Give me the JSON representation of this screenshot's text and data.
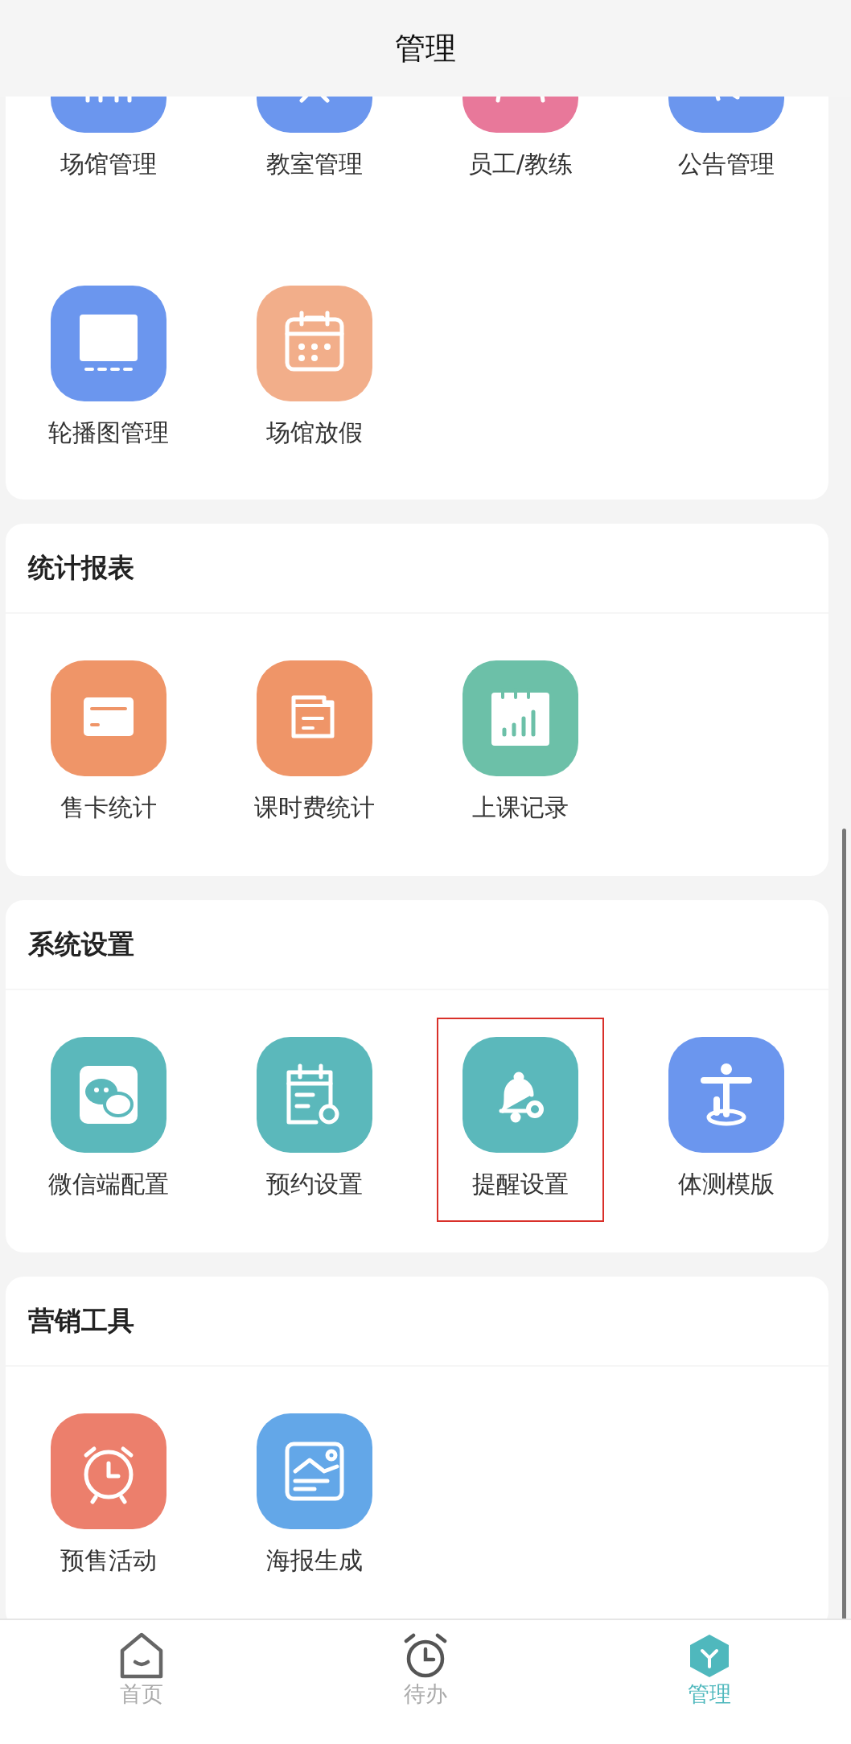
{
  "header": {
    "title": "管理"
  },
  "sections": [
    {
      "items": [
        {
          "label": "场馆管理",
          "kind": "building",
          "color": "#6b96ee"
        },
        {
          "label": "教室管理",
          "kind": "classroom",
          "color": "#6b96ee"
        },
        {
          "label": "员工/教练",
          "kind": "staff",
          "color": "#e8789a"
        },
        {
          "label": "公告管理",
          "kind": "notice",
          "color": "#6b96ee"
        },
        {
          "label": "轮播图管理",
          "kind": "screen",
          "color": "#6b96ee"
        },
        {
          "label": "场馆放假",
          "kind": "calendar",
          "color": "#f2ae8a"
        }
      ]
    },
    {
      "title": "统计报表",
      "items": [
        {
          "label": "售卡统计",
          "kind": "card",
          "color": "#ef9568"
        },
        {
          "label": "课时费统计",
          "kind": "document",
          "color": "#ef9568"
        },
        {
          "label": "上课记录",
          "kind": "chart-calendar",
          "color": "#6cc0a8"
        }
      ]
    },
    {
      "title": "系统设置",
      "items": [
        {
          "label": "微信端配置",
          "kind": "chat",
          "color": "#5bb8bb",
          "highlighted": false
        },
        {
          "label": "预约设置",
          "kind": "calendar-gear",
          "color": "#5bb8bb",
          "highlighted": false
        },
        {
          "label": "提醒设置",
          "kind": "bell-gear",
          "color": "#5bb8bb",
          "highlighted": true
        },
        {
          "label": "体测模版",
          "kind": "person",
          "color": "#6b96ee",
          "highlighted": false
        }
      ]
    },
    {
      "title": "营销工具",
      "items": [
        {
          "label": "预售活动",
          "kind": "alarm",
          "color": "#ec7f6c"
        },
        {
          "label": "海报生成",
          "kind": "image",
          "color": "#63a7e8"
        }
      ]
    }
  ],
  "tabs": [
    {
      "label": "首页",
      "kind": "home",
      "selected": false
    },
    {
      "label": "待办",
      "kind": "alarm",
      "selected": false
    },
    {
      "label": "管理",
      "kind": "hexagon",
      "selected": true
    }
  ]
}
